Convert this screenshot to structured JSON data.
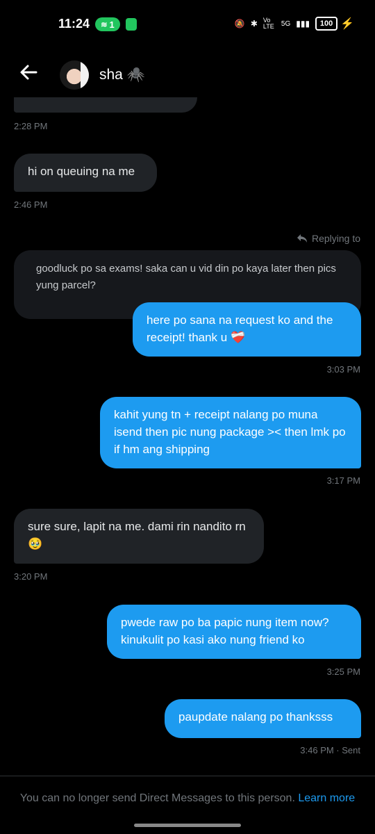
{
  "status_bar": {
    "time": "11:24",
    "hotspot_count": "1",
    "network": "5G",
    "volte": "Vo LTE",
    "battery": "100"
  },
  "header": {
    "contact_name": "sha 🕷️",
    "back_icon": "arrow-left-icon"
  },
  "messages": [
    {
      "side": "left",
      "text": "",
      "time": "2:28 PM"
    },
    {
      "side": "left",
      "text": "hi on queuing na me",
      "time": "2:46 PM"
    },
    {
      "side": "quoted",
      "label": "Replying to",
      "text": "goodluck po sa exams! saka can u vid din po kaya later then pics yung parcel?"
    },
    {
      "side": "right",
      "text": "here po sana na request ko and the receipt! thank u ❤️‍🩹",
      "time": "3:03 PM"
    },
    {
      "side": "right",
      "text": "kahit yung tn + receipt nalang po muna isend then pic nung package >< then lmk po if hm ang shipping",
      "time": "3:17 PM"
    },
    {
      "side": "left",
      "text": "sure sure, lapit na me. dami rin nandito rn 🥹",
      "time": "3:20 PM"
    },
    {
      "side": "right",
      "text": "pwede raw po ba papic nung item now? kinukulit po kasi ako nung friend ko",
      "time": "3:25 PM"
    },
    {
      "side": "right",
      "text": "paupdate nalang po thanksss",
      "time": "3:46 PM · Sent"
    }
  ],
  "footer": {
    "notice": "You can no longer send Direct Messages to this person.",
    "link": "Learn more"
  },
  "colors": {
    "accent": "#1d9bf0",
    "incoming_bubble": "#202327",
    "background": "#000000"
  }
}
